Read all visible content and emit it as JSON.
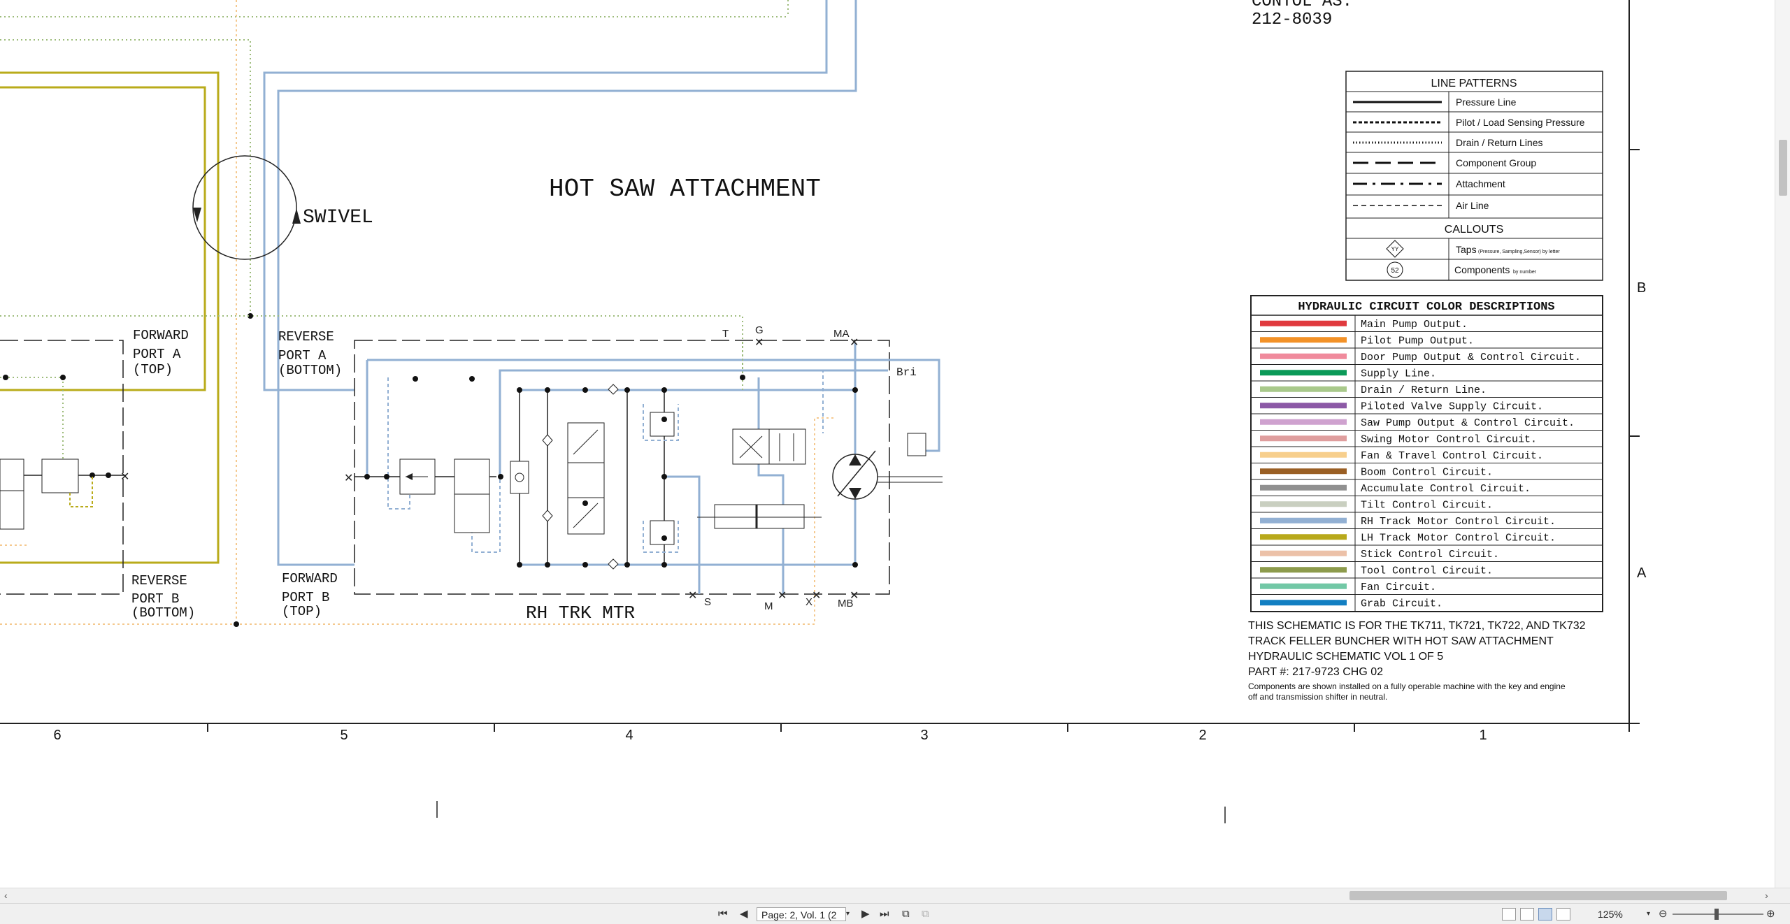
{
  "title_block": {
    "control_as_label": "CONTOL AS.",
    "control_as_number": "212-8039"
  },
  "schematic": {
    "heading": "HOT SAW ATTACHMENT",
    "swivel_label": "SWIVEL",
    "left_ports": {
      "forward_port_a": [
        "FORWARD",
        "PORT A",
        "(TOP)"
      ],
      "reverse_port_b": [
        "REVERSE",
        "PORT B",
        "(BOTTOM)"
      ]
    },
    "rh_motor_ports": {
      "reverse_port_a": [
        "REVERSE",
        "PORT A",
        "(BOTTOM)"
      ],
      "forward_port_b": [
        "FORWARD",
        "PORT B",
        "(TOP)"
      ]
    },
    "rh_motor_label": "RH TRK MTR",
    "tap_labels": {
      "t": "T",
      "g": "G",
      "ma": "MA",
      "bri": "Bri",
      "s": "S",
      "m": "M",
      "x": "X",
      "mb": "MB"
    },
    "colors": {
      "lh_track": "#b9ab1a",
      "rh_track": "#92b0d3",
      "drain": "#9ebc7c",
      "fan_travel": "#f5c98f"
    }
  },
  "line_patterns": {
    "title": "LINE PATTERNS",
    "rows": [
      {
        "pattern": "solid",
        "label": "Pressure Line"
      },
      {
        "pattern": "dashed",
        "label": "Pilot / Load Sensing Pressure"
      },
      {
        "pattern": "dotted",
        "label": "Drain / Return Lines"
      },
      {
        "pattern": "longdash",
        "label": "Component Group"
      },
      {
        "pattern": "dashdot",
        "label": "Attachment"
      },
      {
        "pattern": "thindash",
        "label": "Air Line"
      }
    ],
    "callouts_title": "CALLOUTS",
    "callouts": [
      {
        "symbol": "YY",
        "label": "Taps",
        "sub": "(Pressure, Sampling,Sensor) by letter"
      },
      {
        "symbol": "52",
        "label": "Components",
        "sub": "by number"
      }
    ]
  },
  "color_descriptions": {
    "title": "HYDRAULIC CIRCUIT COLOR DESCRIPTIONS",
    "rows": [
      {
        "color": "#e03a3e",
        "label": "Main Pump Output."
      },
      {
        "color": "#f39228",
        "label": "Pilot Pump Output."
      },
      {
        "color": "#f08a9c",
        "label": "Door Pump Output & Control Circuit."
      },
      {
        "color": "#0b9a58",
        "label": "Supply Line."
      },
      {
        "color": "#a9c98b",
        "label": "Drain / Return Line."
      },
      {
        "color": "#8c59a6",
        "label": "Piloted Valve Supply Circuit."
      },
      {
        "color": "#cfa2cf",
        "label": "Saw Pump Output & Control Circuit."
      },
      {
        "color": "#df9e9e",
        "label": "Swing Motor Control Circuit."
      },
      {
        "color": "#f7cf8d",
        "label": "Fan & Travel Control Circuit."
      },
      {
        "color": "#9a5f24",
        "label": "Boom Control Circuit."
      },
      {
        "color": "#909090",
        "label": "Accumulate Control Circuit."
      },
      {
        "color": "#c9cfc0",
        "label": "Tilt Control Circuit."
      },
      {
        "color": "#92b0d3",
        "label": "RH Track Motor Control Circuit."
      },
      {
        "color": "#b8a91b",
        "label": "LH Track Motor Control Circuit."
      },
      {
        "color": "#ecc1a8",
        "label": "Stick Control Circuit."
      },
      {
        "color": "#8d9b4c",
        "label": "Tool Control Circuit."
      },
      {
        "color": "#72c8a6",
        "label": "Fan Circuit."
      },
      {
        "color": "#127fc2",
        "label": "Grab Circuit."
      }
    ]
  },
  "notes": {
    "line1": "THIS SCHEMATIC IS FOR THE TK711, TK721, TK722, AND TK732",
    "line2": "TRACK FELLER BUNCHER WITH HOT SAW ATTACHMENT",
    "line3": "HYDRAULIC SCHEMATIC VOL 1 OF 5",
    "line4": "PART #: 217-9723 CHG 02",
    "line5": "Components are shown installed on a fully operable machine with the key and engine",
    "line6": "off and transmission shifter in neutral."
  },
  "zones": {
    "columns": [
      "6",
      "5",
      "4",
      "3",
      "2",
      "1"
    ],
    "rows": [
      "B",
      "A"
    ]
  },
  "viewer": {
    "page_field": "Page: 2, Vol. 1 (2",
    "zoom": "125%"
  }
}
